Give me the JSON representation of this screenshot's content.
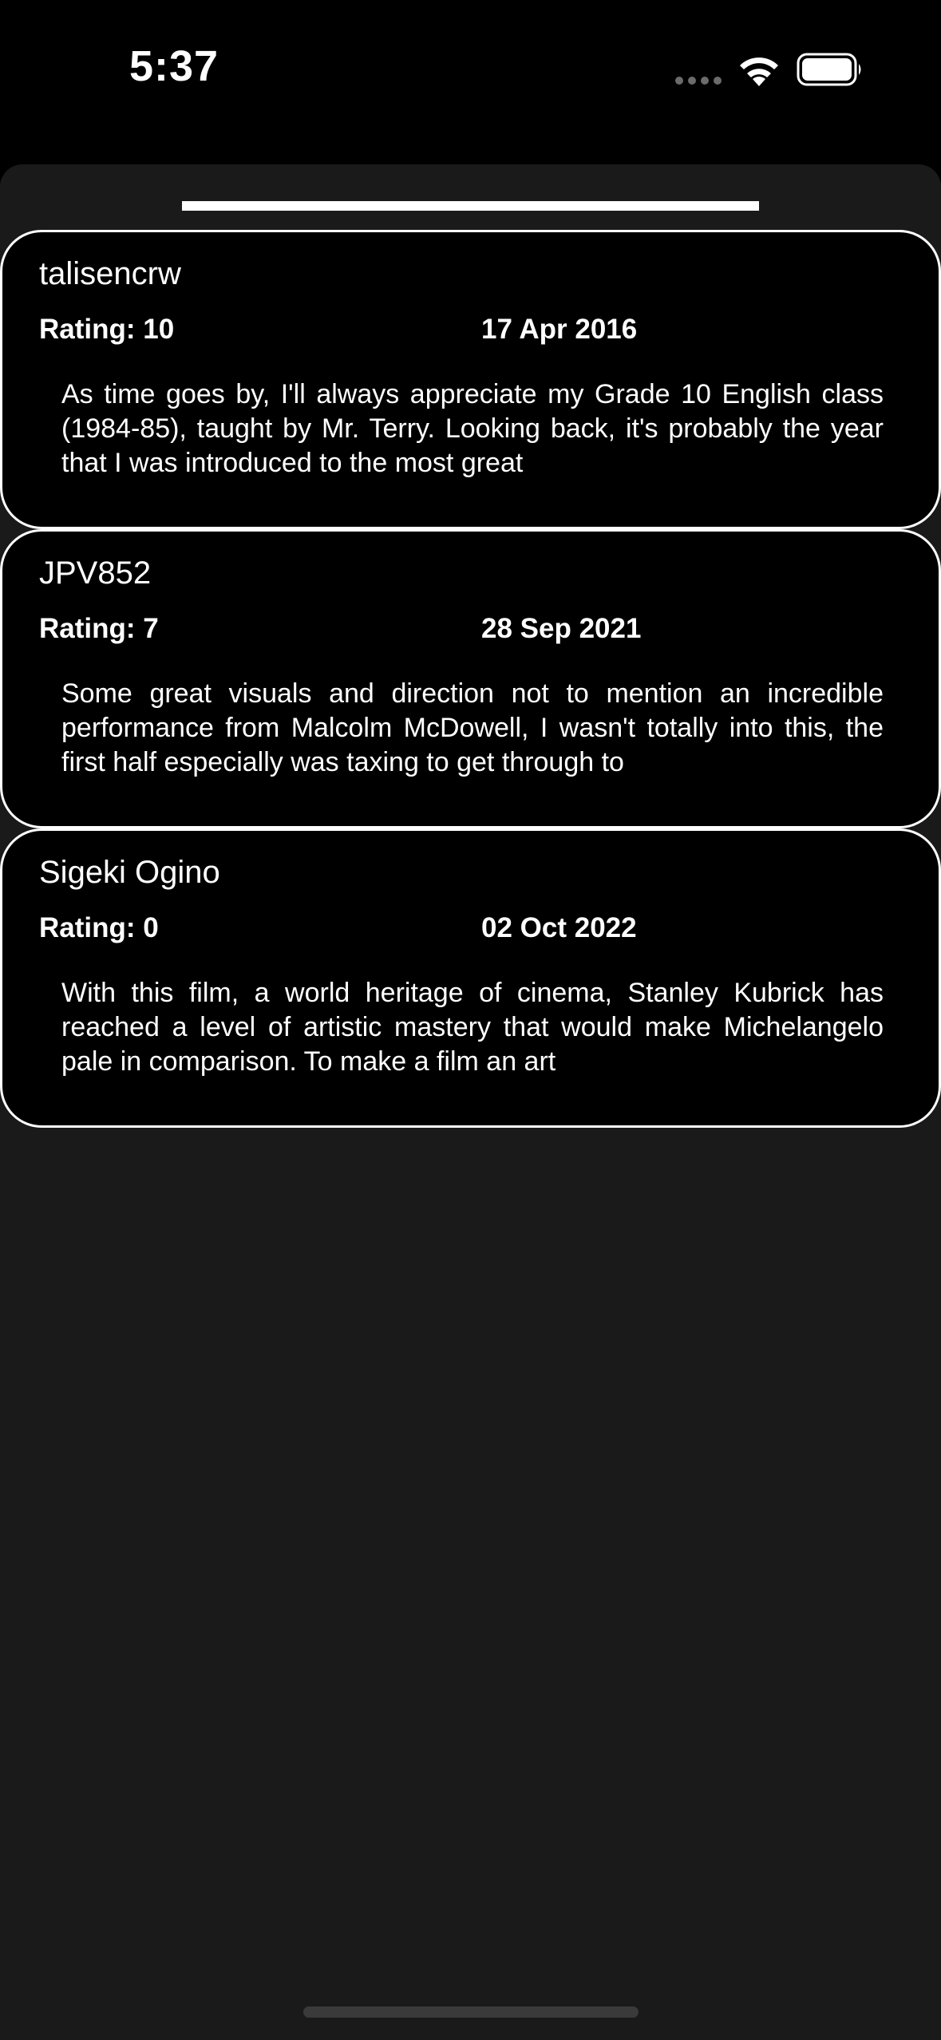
{
  "status_bar": {
    "time": "5:37"
  },
  "reviews": [
    {
      "author": "talisencrw",
      "rating": "Rating: 10",
      "date": "17 Apr 2016",
      "body": "As time goes by, I'll always appreciate my Grade 10 English class (1984-85), taught by Mr. Terry. Looking back, it's probably the year that I was introduced to the most great"
    },
    {
      "author": "JPV852",
      "rating": "Rating: 7",
      "date": "28 Sep 2021",
      "body": "Some great visuals and direction not to mention an incredible performance from Malcolm McDowell, I wasn't totally into this, the first half especially was taxing to get through to"
    },
    {
      "author": "Sigeki Ogino",
      "rating": "Rating: 0",
      "date": "02 Oct 2022",
      "body": "With this film, a world heritage of cinema, Stanley Kubrick has reached a level of artistic mastery that would make Michelangelo pale in comparison. To make a film an art"
    }
  ],
  "icons": {
    "signal": "signal-dots-icon",
    "wifi": "wifi-icon",
    "battery": "battery-icon"
  }
}
